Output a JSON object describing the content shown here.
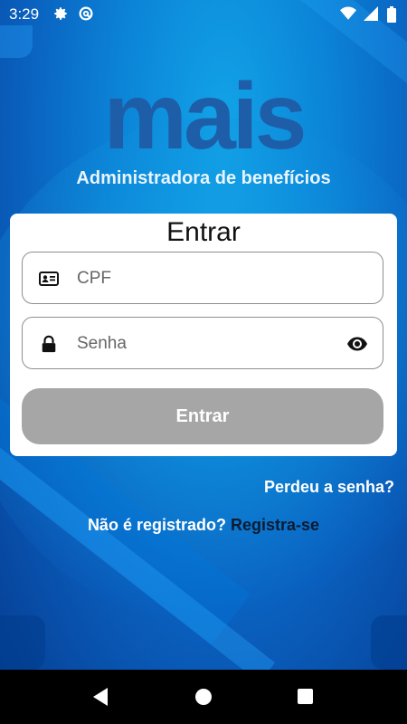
{
  "status_bar": {
    "time": "3:29",
    "icons_left": [
      "settings-icon",
      "at-sign-icon"
    ],
    "icons_right": [
      "wifi-icon",
      "signal-icon",
      "battery-icon"
    ]
  },
  "logo": {
    "word": "mais",
    "subtitle": "Administradora de benefícios"
  },
  "login_card": {
    "title": "Entrar",
    "cpf_placeholder": "CPF",
    "password_placeholder": "Senha",
    "submit_label": "Entrar"
  },
  "links": {
    "forgot_password": "Perdeu a senha?",
    "not_registered": "Não é registrado?",
    "register": "Registra-se"
  },
  "colors": {
    "background": "#0b82d6",
    "logo": "#1e5ea8",
    "button_disabled": "#a6a6a6",
    "card": "#ffffff",
    "register_link": "#0b1b33"
  }
}
